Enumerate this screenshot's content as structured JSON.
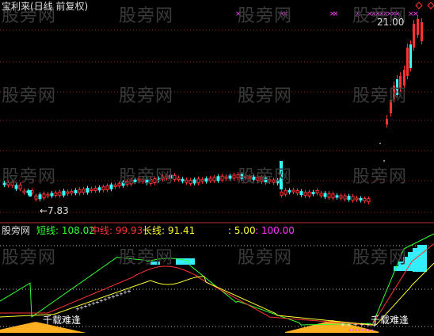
{
  "main_panel": {
    "stock_name": "宝利来",
    "adjust_mode": "(日线 前复权)",
    "high_label": "21.00",
    "low_label": "←7.83"
  },
  "indicator_panel": {
    "name": "股旁网",
    "lines": [
      {
        "label": "短线:",
        "value": "108.02",
        "color": "#33ff33"
      },
      {
        "label": "中线:",
        "value": "99.93",
        "color": "#ff3333"
      },
      {
        "label": "长线:",
        "value": "91.41",
        "color": "#ffff33"
      }
    ],
    "levels": [
      {
        "value": "5.00",
        "color": "#ffff33"
      },
      {
        "value": "100.00",
        "color": "#ff33ff"
      }
    ],
    "annotations": [
      "千载难逢",
      "千载难逢"
    ]
  },
  "watermark": "股旁网",
  "colors": {
    "up": "#ff3333",
    "down": "#33ffff",
    "grid": "#a02020",
    "short_line": "#33ff33",
    "mid_line": "#ff3333",
    "long_line": "#ffff33",
    "bottom_fill": "#ffb020",
    "top_fill": "#33eeff",
    "marker": "#ff44ff"
  }
}
